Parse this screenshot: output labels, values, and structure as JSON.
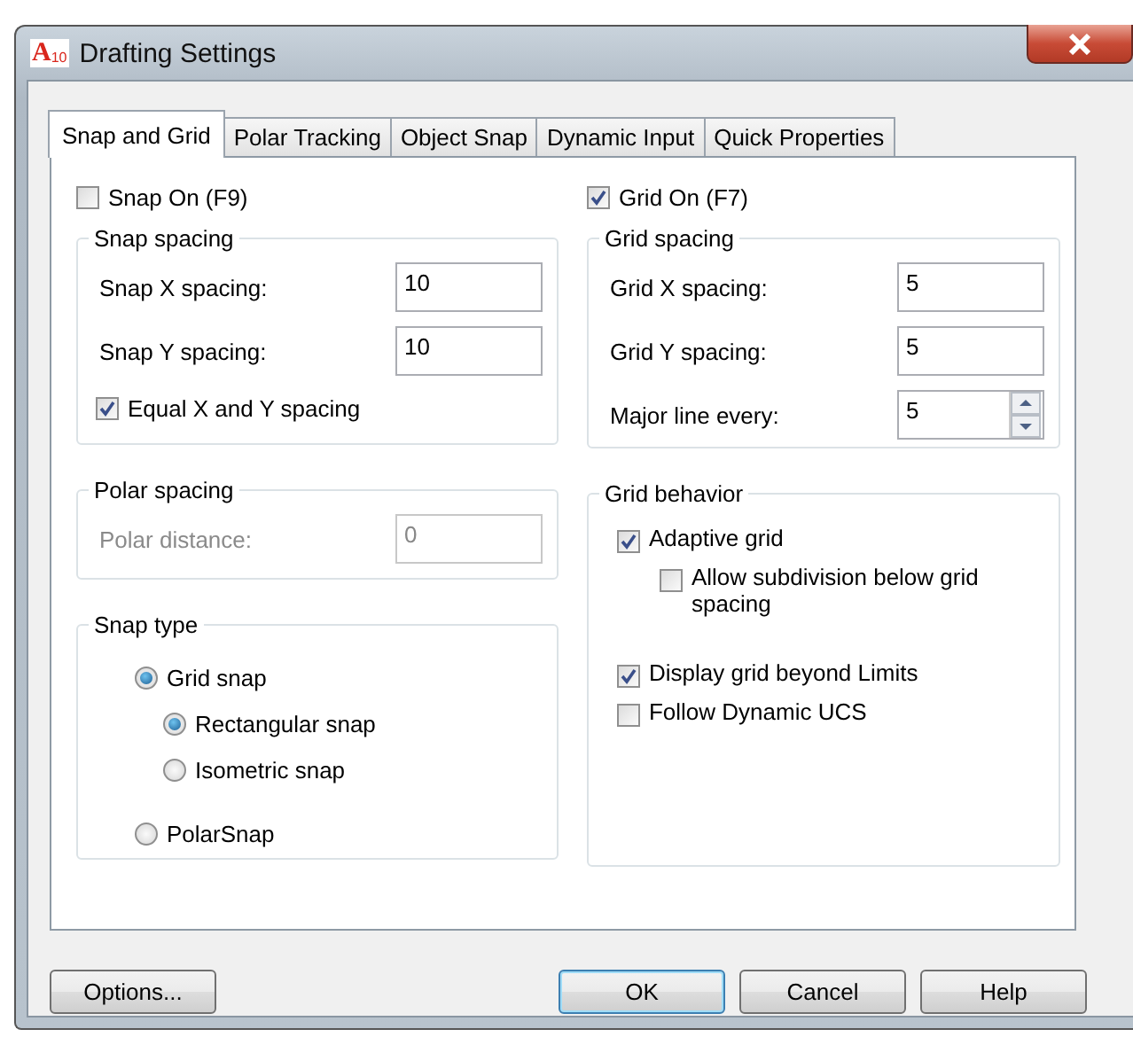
{
  "window": {
    "icon": {
      "letter": "A",
      "version": "10"
    },
    "title": "Drafting Settings"
  },
  "tabs": [
    {
      "label": "Snap and Grid",
      "selected": true
    },
    {
      "label": "Polar Tracking",
      "selected": false
    },
    {
      "label": "Object Snap",
      "selected": false
    },
    {
      "label": "Dynamic Input",
      "selected": false
    },
    {
      "label": "Quick Properties",
      "selected": false
    }
  ],
  "snap_on": {
    "label": "Snap On (F9)",
    "checked": false
  },
  "snap_spacing": {
    "title": "Snap spacing",
    "fields": [
      {
        "label": "Snap X spacing:",
        "value": "10",
        "kind": "text",
        "disabled": false
      },
      {
        "label": "Snap Y spacing:",
        "value": "10",
        "kind": "text",
        "disabled": false
      }
    ],
    "equal_spacing": {
      "label": "Equal X and Y spacing",
      "checked": true
    }
  },
  "polar_spacing": {
    "title": "Polar spacing",
    "fields": [
      {
        "label": "Polar distance:",
        "value": "0",
        "kind": "text",
        "disabled": true
      }
    ]
  },
  "snap_type": {
    "title": "Snap type",
    "options": [
      {
        "label": "Grid snap",
        "selected": true,
        "children": [
          {
            "label": "Rectangular snap",
            "selected": true
          },
          {
            "label": "Isometric snap",
            "selected": false
          }
        ]
      },
      {
        "label": "PolarSnap",
        "selected": false
      }
    ]
  },
  "grid_on": {
    "label": "Grid On (F7)",
    "checked": true
  },
  "grid_spacing": {
    "title": "Grid spacing",
    "fields": [
      {
        "label": "Grid X spacing:",
        "value": "5",
        "kind": "text",
        "disabled": false
      },
      {
        "label": "Grid Y spacing:",
        "value": "5",
        "kind": "text",
        "disabled": false
      },
      {
        "label": "Major line every:",
        "value": "5",
        "kind": "spinner",
        "disabled": false
      }
    ]
  },
  "grid_behavior": {
    "title": "Grid behavior",
    "options": [
      {
        "label": "Adaptive grid",
        "checked": true,
        "children": [
          {
            "label": "Allow subdivision below grid spacing",
            "checked": false
          }
        ]
      },
      {
        "label": "Display grid beyond Limits",
        "checked": true
      },
      {
        "label": "Follow Dynamic UCS",
        "checked": false
      }
    ]
  },
  "buttons": [
    {
      "label": "Options...",
      "default": false
    },
    {
      "label": "OK",
      "default": true
    },
    {
      "label": "Cancel",
      "default": false
    },
    {
      "label": "Help",
      "default": false
    }
  ]
}
